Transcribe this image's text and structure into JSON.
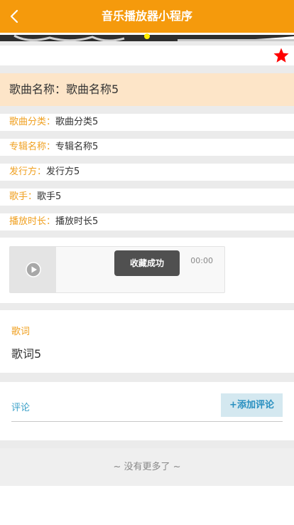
{
  "header": {
    "title": "音乐播放器小程序",
    "back_icon": "chevron-left-icon"
  },
  "banner": {
    "active_dot_color": "#ffee00"
  },
  "favorite": {
    "icon": "star-icon",
    "color": "#ff0000",
    "active": true
  },
  "song": {
    "name_label": "歌曲名称：",
    "name_value": "歌曲名称5",
    "details": [
      {
        "label": "歌曲分类：",
        "value": "歌曲分类5"
      },
      {
        "label": "专辑名称：",
        "value": "专辑名称5"
      },
      {
        "label": "发行方：",
        "value": "发行方5"
      },
      {
        "label": "歌手：",
        "value": "歌手5"
      },
      {
        "label": "播放时长：",
        "value": "播放时长5"
      }
    ]
  },
  "player": {
    "play_icon": "play-icon",
    "time": "00:00"
  },
  "toast": {
    "text": "收藏成功"
  },
  "lyrics": {
    "label": "歌词",
    "text": "歌词5"
  },
  "comments": {
    "label": "评论",
    "add_button": "+添加评论"
  },
  "footer": {
    "text": "~ 没有更多了 ~"
  },
  "colors": {
    "accent": "#f59a0c",
    "label_orange": "#f0a020",
    "link_blue": "#3aa0c8",
    "title_bar_bg": "#fde5c8"
  }
}
